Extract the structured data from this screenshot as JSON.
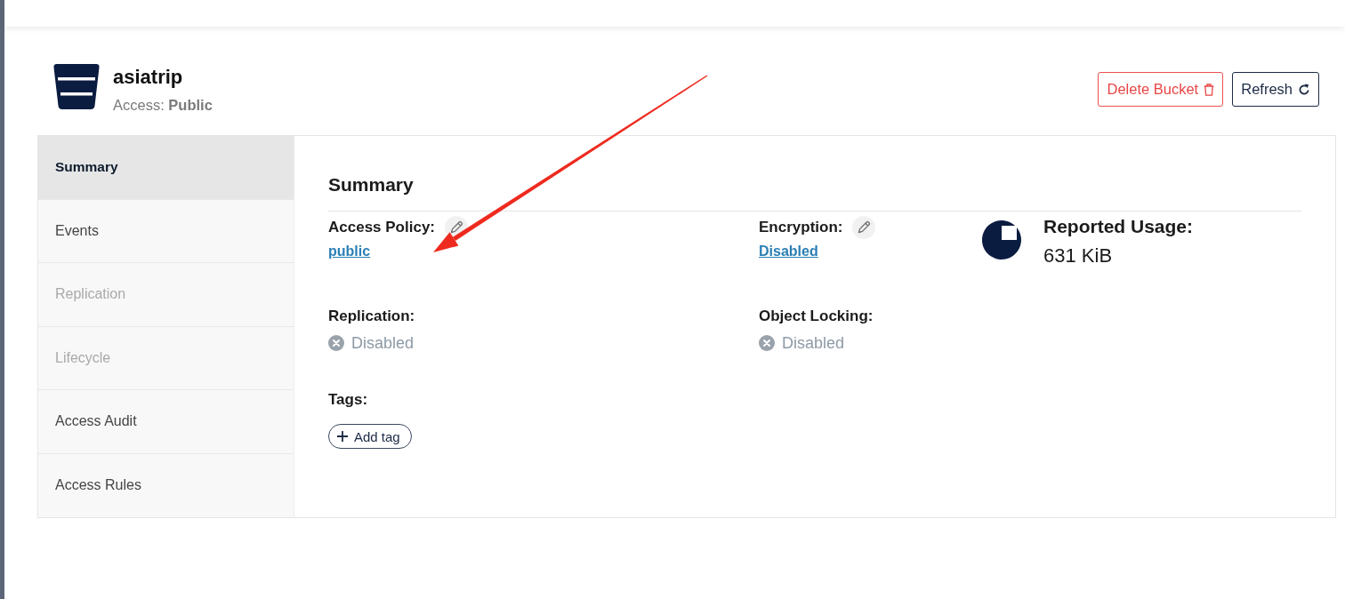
{
  "header": {
    "bucket_name": "asiatrip",
    "access": "Access: **Public**"
  },
  "actions": [
    {
      "label": "Delete Bucket",
      "kind": "delete"
    },
    {
      "label": "Refresh",
      "kind": "refresh"
    }
  ],
  "sidebar": {
    "items": [
      {
        "label": "Summary",
        "selected": true,
        "disabled": false
      },
      {
        "label": "Events",
        "selected": false,
        "disabled": false
      },
      {
        "label": "Replication",
        "selected": false,
        "disabled": true
      },
      {
        "label": "Lifecycle",
        "selected": false,
        "disabled": true
      },
      {
        "label": "Access Audit",
        "selected": false,
        "disabled": false
      },
      {
        "label": "Access Rules",
        "selected": false,
        "disabled": false
      }
    ]
  },
  "summary": {
    "title": "Summary",
    "fields": [
      {
        "label": "Access Policy:",
        "value": "public",
        "kind": "link",
        "editable": true
      },
      {
        "label": "Encryption:",
        "value": "Disabled",
        "kind": "link",
        "editable": true
      },
      {
        "label": "Replication:",
        "value": "Disabled",
        "kind": "status",
        "editable": false
      },
      {
        "label": "Object Locking:",
        "value": "Disabled",
        "kind": "status",
        "editable": false
      }
    ],
    "usage": {
      "label": "Reported Usage:",
      "value": "631 KiB"
    },
    "tags": {
      "label": "Tags:",
      "add_button": "Add tag"
    }
  }
}
